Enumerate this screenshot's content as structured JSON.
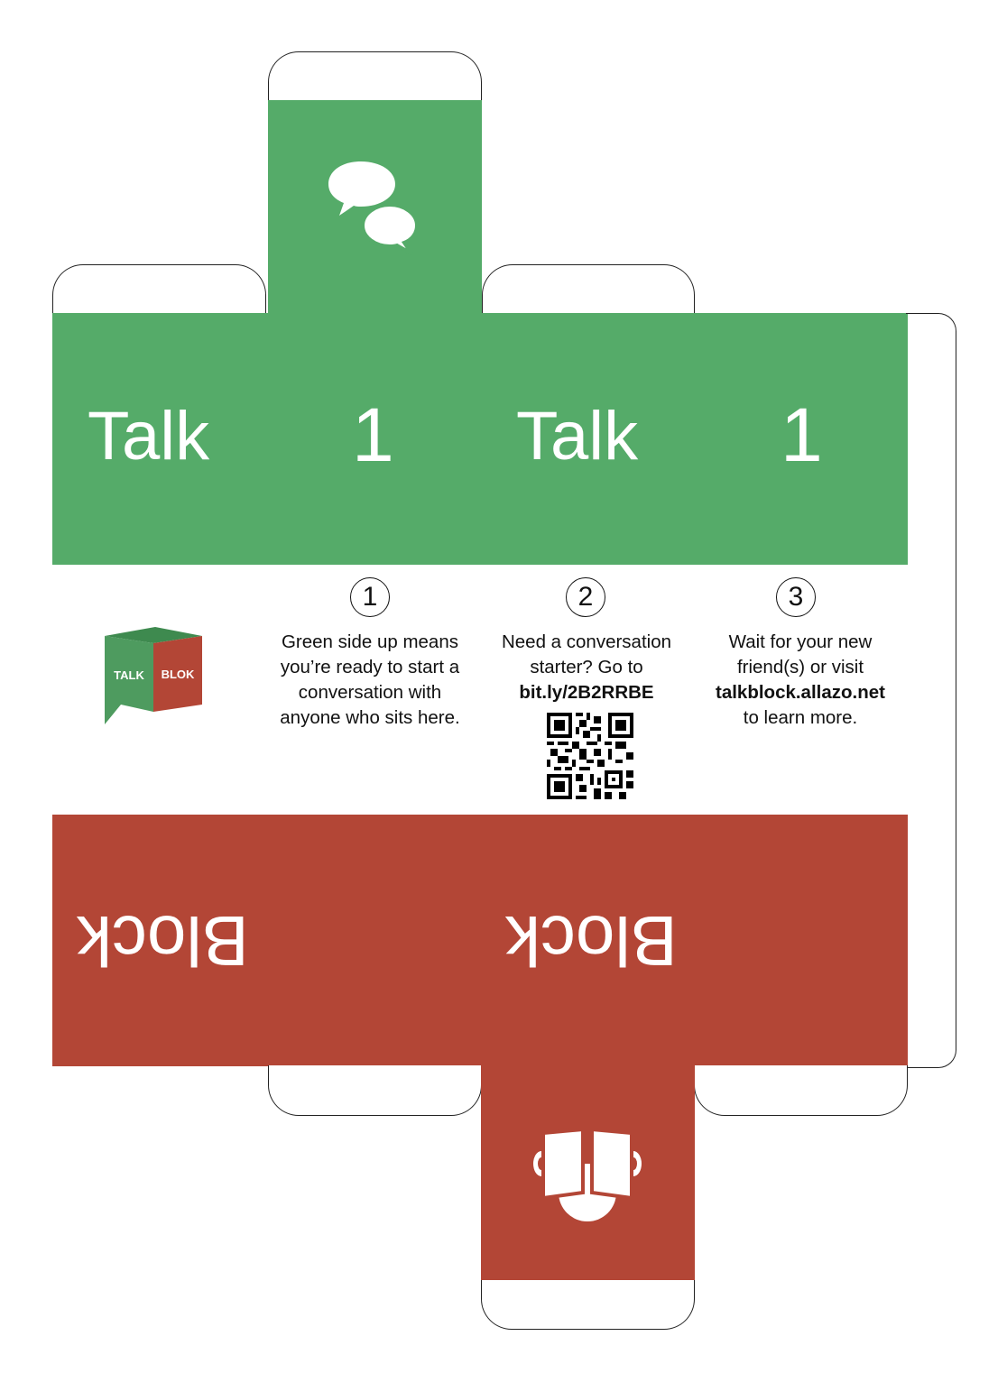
{
  "colors": {
    "green": "#55ab69",
    "red": "#b34636",
    "white": "#ffffff",
    "outline": "#222222"
  },
  "green_band": {
    "word_left": "Talk",
    "number_left": "1",
    "word_right": "Talk",
    "number_right": "1"
  },
  "red_band": {
    "word_left": "Block",
    "word_right": "Block"
  },
  "logo": {
    "talk": "TALK",
    "blok": "BLOK"
  },
  "steps": [
    {
      "number": "1",
      "lines": [
        "Green side up means",
        "you’re ready to start a",
        "conversation with",
        "anyone who sits here."
      ]
    },
    {
      "number": "2",
      "lines": [
        "Need a conversation",
        "starter? Go to"
      ],
      "link": "bit.ly/2B2RRBE"
    },
    {
      "number": "3",
      "lines": [
        "Wait for your new",
        "friend(s) or visit"
      ],
      "link": "talkblock.allazo.net",
      "after": "to learn more."
    }
  ],
  "icons": {
    "top": "speech-bubbles-icon",
    "bottom": "reading-person-icon",
    "qr": "qr-code"
  }
}
